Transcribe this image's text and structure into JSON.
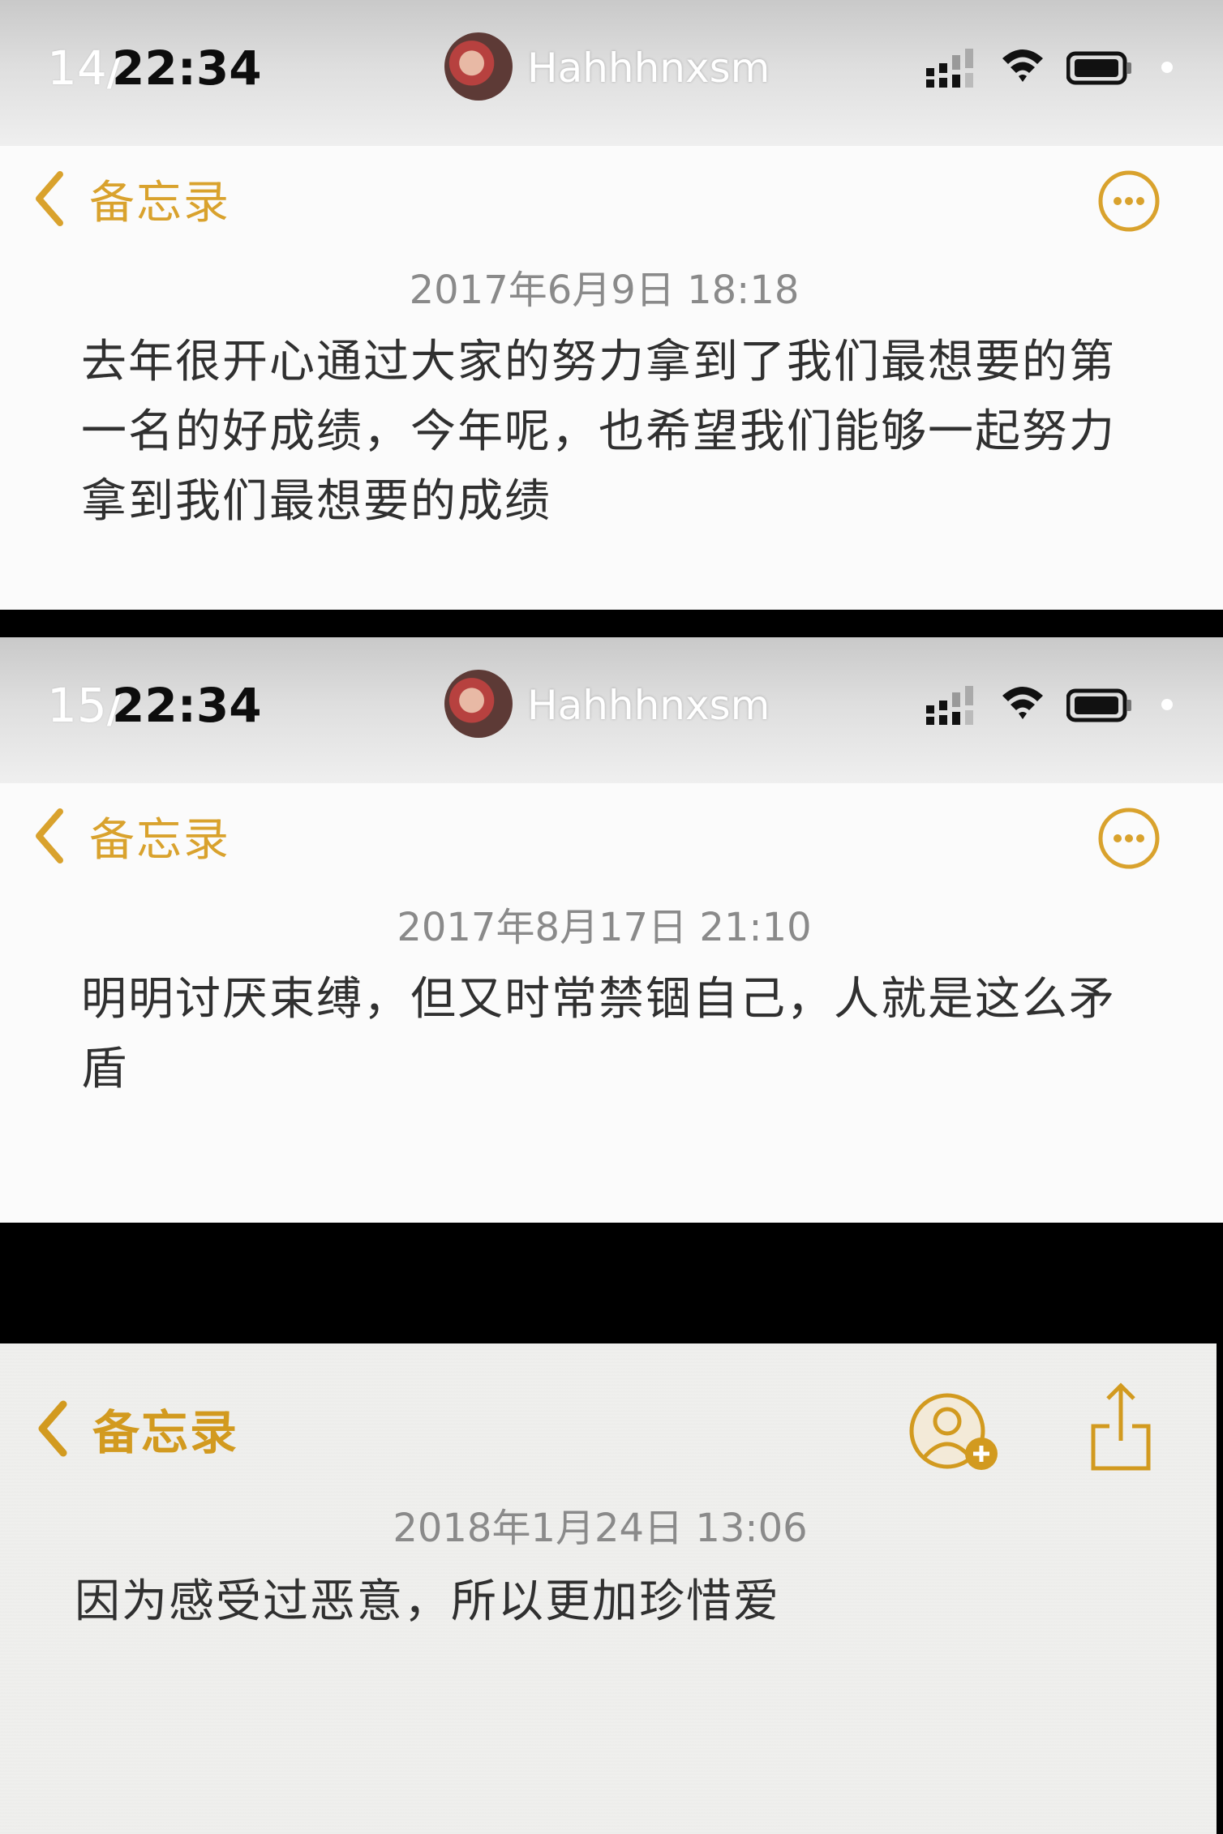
{
  "accent_color": "#d9a22d",
  "panels": [
    {
      "clock_previous": "14/",
      "clock": "22:34",
      "username": "Hahhhnxsm",
      "back_label": "备忘录",
      "date": "2017年6月9日 18:18",
      "text": "去年很开心通过大家的努力拿到了我们最想要的第一名的好成绩，今年呢，也希望我们能够一起努力拿到我们最想要的成绩"
    },
    {
      "clock_previous": "15/",
      "clock": "22:34",
      "username": "Hahhhnxsm",
      "back_label": "备忘录",
      "date": "2017年8月17日 21:10",
      "text": "明明讨厌束缚，但又时常禁锢自己，人就是这么矛盾"
    },
    {
      "back_label": "备忘录",
      "date": "2018年1月24日 13:06",
      "text": "因为感受过恶意，所以更加珍惜爱"
    }
  ],
  "icons": {
    "signal": "signal-icon",
    "wifi": "wifi-icon",
    "battery": "battery-icon",
    "back": "chevron-left-icon",
    "more": "more-icon",
    "add_person": "add-person-icon",
    "share": "share-icon"
  }
}
